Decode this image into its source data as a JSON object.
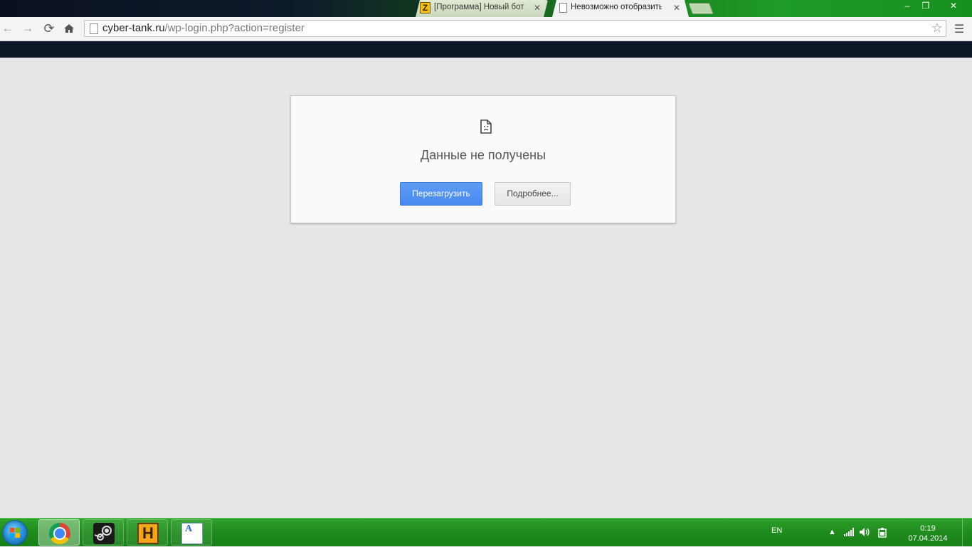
{
  "tabs": [
    {
      "title": "[Программа] Новый бот",
      "icon": "zaycev-favicon"
    },
    {
      "title": "Невозможно отобразить",
      "icon": "page-icon"
    }
  ],
  "window_controls": {
    "minimize": "–",
    "maximize": "❐",
    "close": "✕"
  },
  "toolbar": {
    "url_host": "cyber-tank.ru",
    "url_path": "/wp-login.php?action=register"
  },
  "error": {
    "title": "Данные не получены",
    "reload_label": "Перезагрузить",
    "details_label": "Подробнее..."
  },
  "taskbar": {
    "apps": [
      "chrome-icon",
      "steam-icon",
      "h-app-icon",
      "font-viewer-icon"
    ],
    "language": "EN",
    "time": "0:19",
    "date": "07.04.2014"
  },
  "colors": {
    "accent_button": "#4a8af0",
    "taskbar": "#1f8a1d",
    "page_bg": "#e6e6e6"
  }
}
